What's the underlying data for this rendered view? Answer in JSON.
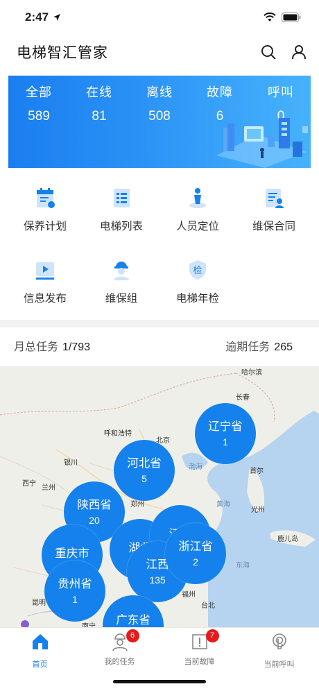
{
  "status": {
    "time": "2:47"
  },
  "header": {
    "title": "电梯智汇管家"
  },
  "stats": [
    {
      "label": "全部",
      "value": "589"
    },
    {
      "label": "在线",
      "value": "81"
    },
    {
      "label": "离线",
      "value": "508"
    },
    {
      "label": "故障",
      "value": "6"
    },
    {
      "label": "呼叫",
      "value": "0"
    }
  ],
  "menu": [
    {
      "label": "保养计划",
      "icon": "calendar-icon"
    },
    {
      "label": "电梯列表",
      "icon": "list-icon"
    },
    {
      "label": "人员定位",
      "icon": "person-location-icon"
    },
    {
      "label": "维保合同",
      "icon": "contract-icon"
    },
    {
      "label": "信息发布",
      "icon": "video-icon"
    },
    {
      "label": "维保组",
      "icon": "worker-icon"
    },
    {
      "label": "电梯年检",
      "icon": "inspection-shield-icon"
    }
  ],
  "inspect_char": "检",
  "tasks": {
    "monthly_label": "月总任务",
    "monthly_value": "1/793",
    "overdue_label": "逾期任务",
    "overdue_value": "265"
  },
  "map": {
    "cities": [
      "哈尔滨",
      "长春",
      "呼和浩特",
      "北京",
      "银川",
      "西宁",
      "兰州",
      "郑州",
      "首尔",
      "光州",
      "鹿儿岛",
      "昆明",
      "南宁",
      "福州",
      "台北"
    ],
    "seas": [
      "渤海",
      "黄海",
      "东海"
    ],
    "clusters": [
      {
        "name": "辽宁省",
        "count": "1"
      },
      {
        "name": "河北省",
        "count": "5"
      },
      {
        "name": "陕西省",
        "count": "20"
      },
      {
        "name": "湖北",
        "count": ""
      },
      {
        "name": "江苏",
        "count": ""
      },
      {
        "name": "江西",
        "count": "135"
      },
      {
        "name": "浙江省",
        "count": "2"
      },
      {
        "name": "重庆市",
        "count": ""
      },
      {
        "name": "贵州省",
        "count": "1"
      },
      {
        "name": "广东省",
        "count": ""
      }
    ]
  },
  "tabbar": {
    "tabs": [
      {
        "label": "首页",
        "badge": ""
      },
      {
        "label": "我的任务",
        "badge": "6"
      },
      {
        "label": "当前故障",
        "badge": "7"
      },
      {
        "label": "当前呼叫",
        "badge": ""
      }
    ]
  },
  "colors": {
    "primary": "#1581ec",
    "badge": "#e8191a",
    "banner_start": "#1a7ef0",
    "banner_end": "#47b2fb"
  }
}
